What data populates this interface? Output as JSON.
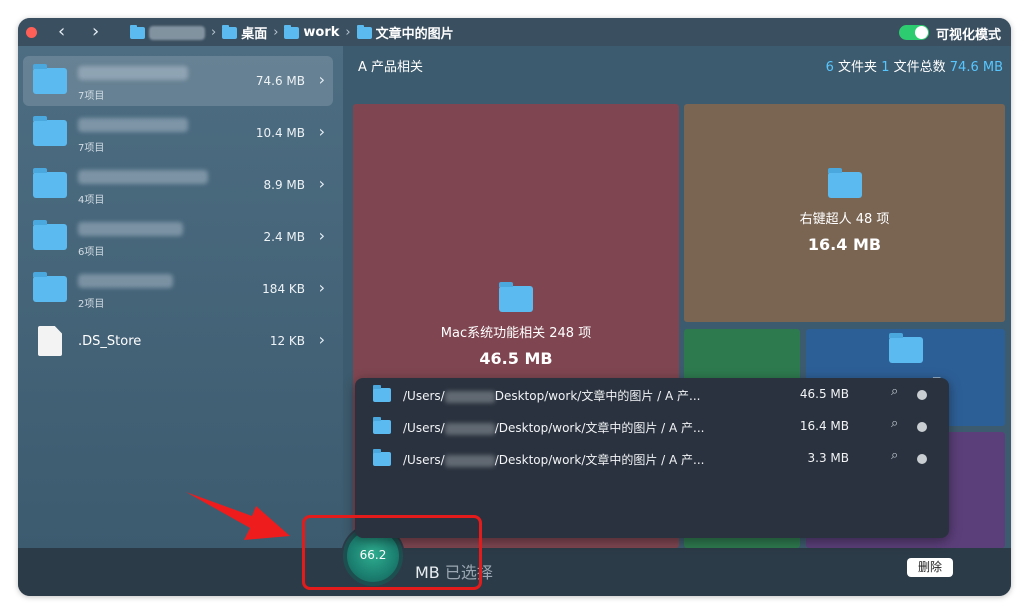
{
  "titlebar": {
    "back": "‹",
    "forward": "›",
    "crumbs": [
      "桌面",
      "work",
      "文章中的图片"
    ],
    "visual_mode_label": "可视化模式"
  },
  "sidebar": {
    "rows": [
      {
        "count": "7项目",
        "size": "74.6 MB"
      },
      {
        "count": "7项目",
        "size": "10.4 MB"
      },
      {
        "count": "4项目",
        "size": "8.9 MB"
      },
      {
        "count": "6项目",
        "size": "2.4 MB"
      },
      {
        "count": "2项目",
        "size": "184 KB"
      }
    ],
    "file": {
      "name": ".DS_Store",
      "size": "12 KB"
    }
  },
  "main": {
    "heading": "A 产品相关",
    "stats": {
      "folders": "6",
      "folders_label": "文件夹",
      "files": "1",
      "files_label": "文件总数",
      "total": "74.6 MB"
    },
    "tiles": [
      {
        "name": "Mac系统功能相关 248 项",
        "size": "46.5 MB",
        "color": "#7f4651"
      },
      {
        "name": "右键超人 48 项",
        "size": "16.4 MB",
        "color": "#7a6553"
      },
      {
        "name": "NTFS 23 项",
        "size": "3.3 MB",
        "color": "#2d5f97"
      }
    ]
  },
  "popup": {
    "rows": [
      {
        "prefix": "/Users/",
        "suffix": "Desktop/work/文章中的图片 / A 产...",
        "size": "46.5 MB"
      },
      {
        "prefix": "/Users/",
        "suffix": "/Desktop/work/文章中的图片 / A 产...",
        "size": "16.4 MB"
      },
      {
        "prefix": "/Users/",
        "suffix": "/Desktop/work/文章中的图片 / A 产...",
        "size": "3.3 MB"
      }
    ]
  },
  "bottom": {
    "selected_value": "66.2",
    "unit": "MB",
    "selected_label": "已选择",
    "delete_label": "删除"
  }
}
